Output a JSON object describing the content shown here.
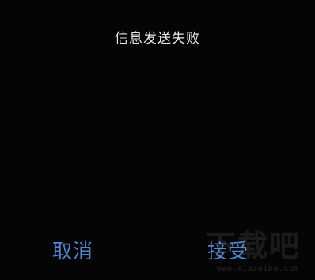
{
  "dialog": {
    "title": "信息发送失败",
    "cancel_label": "取消",
    "accept_label": "接受"
  },
  "watermark": {
    "logo_text": "下载吧",
    "url": "www.xiazaiba.com"
  },
  "colors": {
    "background": "#050505",
    "title_text": "#e6e6e6",
    "action_text": "#4a86d6"
  }
}
